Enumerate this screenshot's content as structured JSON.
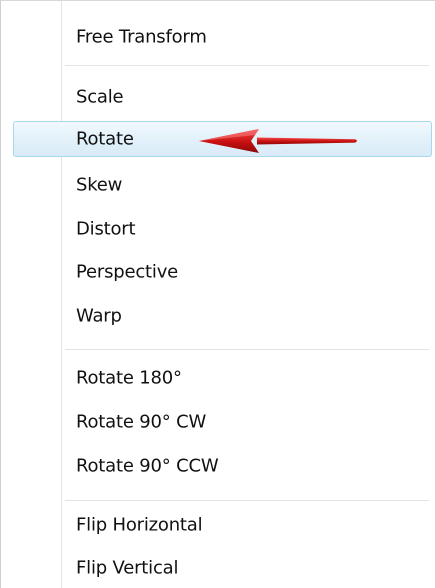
{
  "menu": {
    "items": [
      {
        "label": "Free Transform"
      },
      {
        "label": "Scale"
      },
      {
        "label": "Rotate"
      },
      {
        "label": "Skew"
      },
      {
        "label": "Distort"
      },
      {
        "label": "Perspective"
      },
      {
        "label": "Warp"
      },
      {
        "label": "Rotate 180°"
      },
      {
        "label": "Rotate 90° CW"
      },
      {
        "label": "Rotate 90° CCW"
      },
      {
        "label": "Flip Horizontal"
      },
      {
        "label": "Flip Vertical"
      }
    ],
    "highlighted_item": "Rotate"
  },
  "annotation": {
    "icon": "red-arrow-icon",
    "color": "#d61515"
  },
  "colors": {
    "highlight_border": "#a8d8eb",
    "highlight_fill": "#e3f1fa",
    "separator": "#e2e3e3"
  }
}
